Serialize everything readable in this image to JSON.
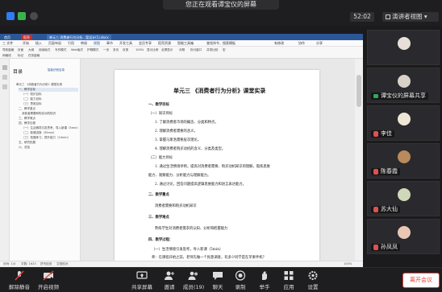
{
  "topbar": {
    "banner": "您正在观看谭宝仪的屏幕",
    "clock": "52:02",
    "view_button": "演讲者视图"
  },
  "wps": {
    "tabs": [
      "首页",
      "稻壳",
      "单元三 消费者行为分析...案设计(1).docx"
    ],
    "menus": [
      "三 文件",
      "开始",
      "插入",
      "页面布局",
      "引用",
      "审阅",
      "视图",
      "章节",
      "开发工具",
      "会员专享",
      "稻壳资源",
      "智能工具箱",
      "查找命令、搜索模板",
      "有修改",
      "协作",
      "分享"
    ],
    "ribbon": [
      "导航窗格",
      "页面",
      "大纲",
      "阅读版式",
      "写作模式",
      "Web版式",
      "护眼模式",
      "一页",
      "多页",
      "页宽",
      "100%",
      "显示比例",
      "网格线",
      "标记",
      "任务窗格",
      "全屏显示",
      "对照",
      "拆分窗口",
      "并排比较",
      "宏"
    ],
    "status": [
      "页码: 1/4",
      "字数: 1623",
      "拼写检查",
      "文档校对",
      "100%"
    ]
  },
  "toc": {
    "title": "目录",
    "action": "智能识别目录",
    "items": [
      "单元三 《消费者行为分析》课堂实录",
      "一、教学目标",
      "（一）知识目标",
      "（二）能力目标",
      "（三）思政目标",
      "二、教学重点",
      "消费者需要和购买动机知识",
      "三、教学难点",
      "四、教学过程",
      "（一）生活情境引发思考，导入新课（5min）",
      "（二）新课讲授（30min）",
      "（三）拓展练习，提升能力（10min）",
      "五、研究拓展",
      "六、总结"
    ]
  },
  "document": {
    "title": "单元三 《消费者行为分析》课堂实录",
    "lines": [
      "一、教学目标",
      "（一）知识目标",
      "1. 了解消费者市场的概念、分类和特点。",
      "2. 理解消费者需要的含义。",
      "3. 掌握马斯洛需要层次理论。",
      "4. 理解消费者购买动机的含义、分类及类型。",
      "（二）能力目标",
      "1. 通过生活情境举例，提高对消费者需要、购买动机知识的理解，锻炼思维",
      "能力、观察能力、分析能力与理解能力。",
      "2. 通过讨论，回答问题提高逻辑思维能力和语言表达能力。",
      "二、教学重点",
      "消费者需要和购买动机知识",
      "三、教学难点",
      "熟练学生对消费者需求的认知、分析和把握能力",
      "四、教学过程：",
      "（一）生活情境引发思考，导入新课（5min）",
      "师：在课程开始之前，老师先做一个民意调查，有多少同学是在苹果手机？"
    ]
  },
  "participants": [
    {
      "name": "",
      "muted": true
    },
    {
      "name": "谭宝仪的屏幕共享",
      "muted": false
    },
    {
      "name": "李佳",
      "muted": true
    },
    {
      "name": "陈春霞",
      "muted": true
    },
    {
      "name": "苏大仙",
      "muted": true
    },
    {
      "name": "孙凤凤",
      "muted": true
    }
  ],
  "toolbar": {
    "buttons": [
      "解除静音",
      "开启视频",
      "共享屏幕",
      "邀请",
      "成员(19)",
      "聊天",
      "录制",
      "举手",
      "应用",
      "设置"
    ],
    "leave": "离开会议"
  },
  "colors": {
    "accent": "#2b5797",
    "leave": "#e5413b",
    "share": "#31a95c"
  }
}
